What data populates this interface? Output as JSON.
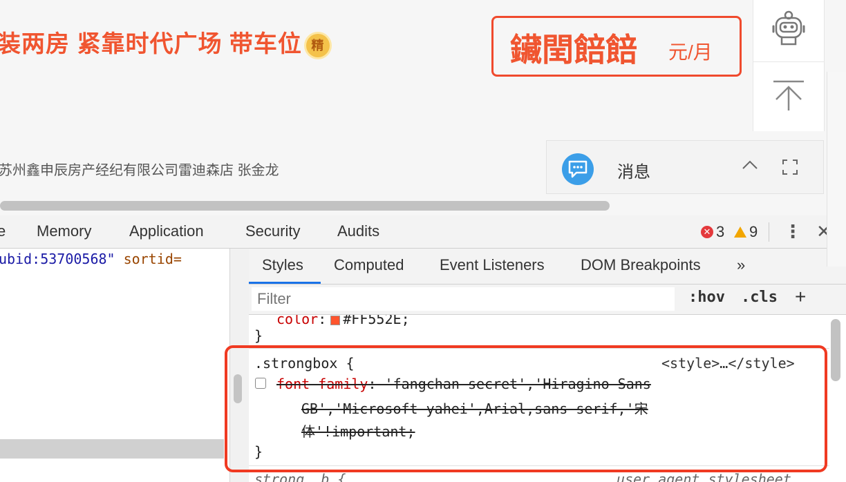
{
  "webpage": {
    "listing_title": "装两房 紧靠时代广场 带车位",
    "badge_label": "精",
    "price_value": "鑶閏餢餢",
    "price_unit": "元/月",
    "agent_line": "苏州鑫申辰房产经纪有限公司雷迪森店 张金龙",
    "side_rail": {
      "service_icon": "robot-service-icon",
      "back_top_icon": "back-to-top-icon"
    },
    "message_panel": {
      "label": "消息",
      "icon": "chat-bubble-icon"
    }
  },
  "devtools": {
    "tabs": [
      "e",
      "Memory",
      "Application",
      "Security",
      "Audits"
    ],
    "error_count": "3",
    "warning_count": "9",
    "more_glyph": "⋮",
    "close_glyph": "✕",
    "elements_code": {
      "attr1": "ubid:53700568",
      "quote": "\"",
      "attr2": "sortid="
    },
    "styles_tabs": [
      "Styles",
      "Computed",
      "Event Listeners",
      "DOM Breakpoints",
      "»"
    ],
    "filter_placeholder": "Filter",
    "hov_label": ":hov",
    "cls_label": ".cls",
    "plus_label": "+",
    "prev_rule": {
      "property": "color",
      "value": "#FF552E",
      "close_brace": "}"
    },
    "strongbox_rule": {
      "selector": ".strongbox {",
      "source": "<style>…</style>",
      "property": "font-family",
      "value_line1": ": 'fangchan-secret','Hiragino Sans",
      "value_line2": "GB','Microsoft yahei',Arial,sans-serif,'宋",
      "value_line3": "体'!important;",
      "close_brace": "}"
    },
    "next_rule": {
      "selector": "strong, b {",
      "source": "user agent stylesheet"
    }
  },
  "colors": {
    "accent_orange": "#f05530",
    "annotation_red": "#f03a22",
    "swatch": "#ff552e",
    "tab_underline": "#1a73e8"
  }
}
